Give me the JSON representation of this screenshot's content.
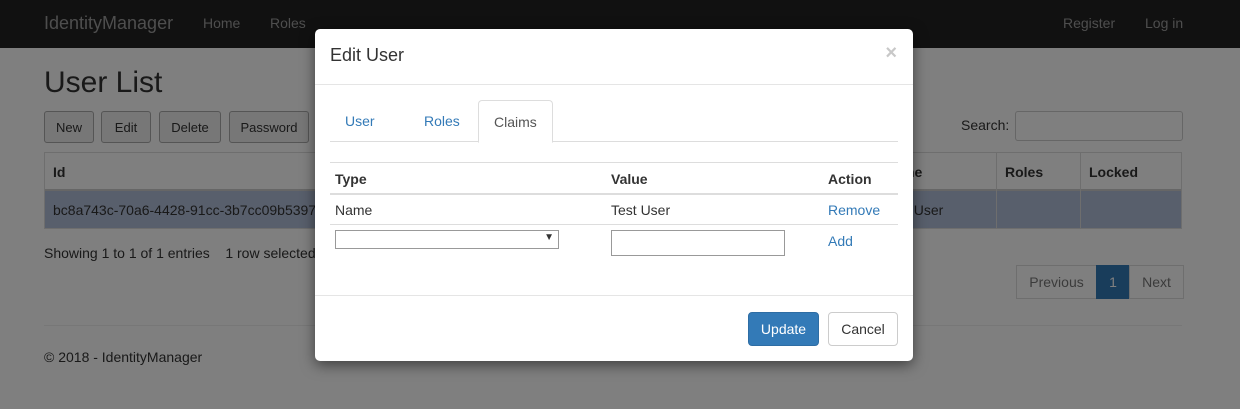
{
  "navbar": {
    "brand": "IdentityManager",
    "links": [
      "Home",
      "Roles"
    ],
    "right_links": [
      "Register",
      "Log in"
    ]
  },
  "page": {
    "title": "User List",
    "toolbar": [
      "New",
      "Edit",
      "Delete",
      "Password"
    ],
    "search_label": "Search:",
    "search_value": "",
    "table": {
      "columns": [
        "Id",
        "Roles",
        "Locked"
      ],
      "column_partial_visible": "ne",
      "rows": [
        {
          "id": "bc8a743c-70a6-4428-91cc-3b7cc09b5397",
          "name_partial": "t User",
          "roles": "",
          "locked": ""
        }
      ]
    },
    "info": "Showing 1 to 1 of 1 entries",
    "selected_info": "1 row selected",
    "pagination": [
      "Previous",
      "1",
      "Next"
    ],
    "footer": "© 2018 - IdentityManager"
  },
  "modal": {
    "title": "Edit User",
    "close_glyph": "×",
    "tabs": [
      "User",
      "Roles",
      "Claims"
    ],
    "active_tab": "Claims",
    "claims": {
      "headers": [
        "Type",
        "Value",
        "Action"
      ],
      "rows": [
        {
          "type": "Name",
          "value": "Test User",
          "action": "Remove"
        }
      ],
      "new_row": {
        "type_selected": "",
        "value": "",
        "action": "Add"
      }
    },
    "buttons": {
      "update": "Update",
      "cancel": "Cancel"
    }
  }
}
